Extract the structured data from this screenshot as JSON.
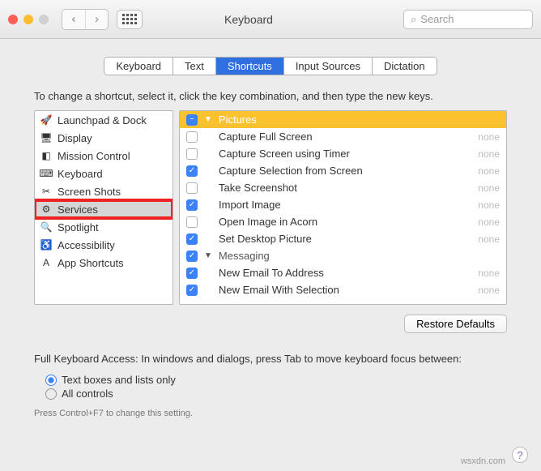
{
  "window": {
    "title": "Keyboard",
    "search_placeholder": "Search"
  },
  "tabs": [
    "Keyboard",
    "Text",
    "Shortcuts",
    "Input Sources",
    "Dictation"
  ],
  "active_tab": 2,
  "instruction": "To change a shortcut, select it, click the key combination, and then type the new keys.",
  "sidebar": {
    "items": [
      {
        "label": "Launchpad & Dock",
        "icon": "🚀"
      },
      {
        "label": "Display",
        "icon": "🖥"
      },
      {
        "label": "Mission Control",
        "icon": "◧"
      },
      {
        "label": "Keyboard",
        "icon": "⌨"
      },
      {
        "label": "Screen Shots",
        "icon": "✂"
      },
      {
        "label": "Services",
        "icon": "⚙",
        "selected": true,
        "highlight": true
      },
      {
        "label": "Spotlight",
        "icon": "🔍"
      },
      {
        "label": "Accessibility",
        "icon": "♿"
      },
      {
        "label": "App Shortcuts",
        "icon": "A"
      }
    ]
  },
  "main": {
    "groups": [
      {
        "type": "cat",
        "label": "Pictures",
        "state": "mixed",
        "expanded": true,
        "hl": true
      },
      {
        "type": "item",
        "label": "Capture Full Screen",
        "state": "off",
        "shortcut": "none"
      },
      {
        "type": "item",
        "label": "Capture Screen using Timer",
        "state": "off",
        "shortcut": "none"
      },
      {
        "type": "item",
        "label": "Capture Selection from Screen",
        "state": "on",
        "shortcut": "none"
      },
      {
        "type": "item",
        "label": "Take Screenshot",
        "state": "off",
        "shortcut": "none"
      },
      {
        "type": "item",
        "label": "Import Image",
        "state": "on",
        "shortcut": "none"
      },
      {
        "type": "item",
        "label": "Open Image in Acorn",
        "state": "off",
        "shortcut": "none"
      },
      {
        "type": "item",
        "label": "Set Desktop Picture",
        "state": "on",
        "shortcut": "none"
      },
      {
        "type": "cat",
        "label": "Messaging",
        "state": "on",
        "expanded": true,
        "sub": true
      },
      {
        "type": "item",
        "label": "New Email To Address",
        "state": "on",
        "shortcut": "none"
      },
      {
        "type": "item",
        "label": "New Email With Selection",
        "state": "on",
        "shortcut": "none"
      }
    ]
  },
  "restore": "Restore Defaults",
  "fka": {
    "label": "Full Keyboard Access: In windows and dialogs, press Tab to move keyboard focus between:",
    "options": [
      "Text boxes and lists only",
      "All controls"
    ],
    "selected": 0,
    "hint": "Press Control+F7 to change this setting."
  },
  "watermark": "wsxdn.com"
}
